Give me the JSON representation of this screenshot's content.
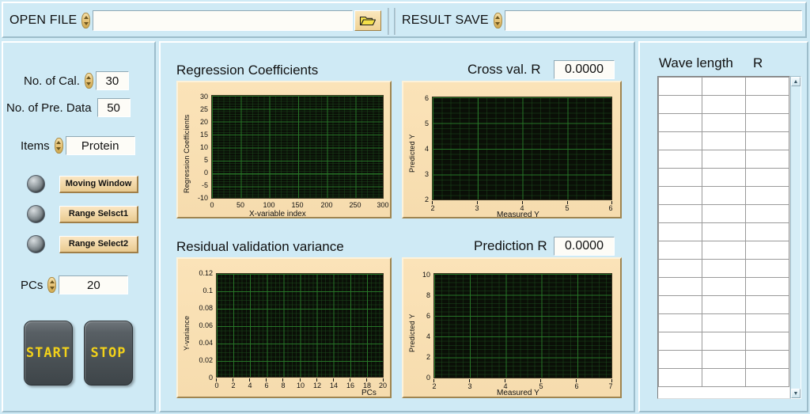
{
  "topbar": {
    "open_file_label": "OPEN FILE",
    "open_file_value": "",
    "open_file_icon": "folder-open-icon",
    "result_save_label": "RESULT SAVE",
    "result_save_value": ""
  },
  "controls": {
    "no_of_cal_label": "No. of Cal.",
    "no_of_cal_value": "30",
    "no_of_pre_data_label": "No. of Pre. Data",
    "no_of_pre_data_value": "50",
    "items_label": "Items",
    "items_value": "Protein",
    "pcs_label": "PCs",
    "pcs_value": "20",
    "toggles": [
      {
        "label": "Moving Window",
        "led": "off"
      },
      {
        "label": "Range Selsct1",
        "led": "off"
      },
      {
        "label": "Range Select2",
        "led": "off"
      }
    ],
    "start_label": "START",
    "stop_label": "STOP"
  },
  "readouts": {
    "cross_val_label": "Cross val. R",
    "cross_val_value": "0.0000",
    "prediction_label": "Prediction R",
    "prediction_value": "0.0000"
  },
  "table": {
    "header_wavelength": "Wave length",
    "header_r": "R",
    "columns": 3,
    "rows": 17,
    "cells": []
  },
  "colors": {
    "panel_bg": "#cfeaf5",
    "graph_bg": "#f8dfb0",
    "plot_bg": "#0a0f07",
    "grid_major": "#287828",
    "lcd_text": "#f2d11a",
    "tan_button": "#f0d6a4"
  },
  "chart_data": [
    {
      "id": "regression-coefficients",
      "type": "line",
      "title": "Regression Coefficients",
      "xlabel": "X-variable index",
      "ylabel": "Regression Coefficients",
      "xlim": [
        0,
        300
      ],
      "ylim": [
        -10,
        30
      ],
      "xticks": [
        "0",
        "50",
        "100",
        "150",
        "200",
        "250",
        "300"
      ],
      "yticks": [
        "30",
        "25",
        "20",
        "15",
        "10",
        "5",
        "0",
        "-5",
        "-10"
      ],
      "series": [
        {
          "name": "regression coefficients",
          "values": []
        }
      ],
      "grid": true,
      "legend": "none",
      "note": "empty plot - no data rendered"
    },
    {
      "id": "cross-validation",
      "type": "scatter",
      "title": "Cross val. R",
      "xlabel": "Measured Y",
      "ylabel": "Predicted Y",
      "xlim": [
        2,
        6
      ],
      "ylim": [
        2,
        6
      ],
      "xticks": [
        "2",
        "3",
        "4",
        "5",
        "6"
      ],
      "yticks": [
        "6",
        "5",
        "4",
        "3",
        "2"
      ],
      "series": [
        {
          "name": "cross validation",
          "values": []
        }
      ],
      "grid": true,
      "legend": "none",
      "note": "empty plot - no data rendered"
    },
    {
      "id": "residual-validation-variance",
      "type": "line",
      "title": "Residual validation variance",
      "xlabel": "PCs",
      "ylabel": "Y-variance",
      "xlim": [
        0,
        20
      ],
      "ylim": [
        0,
        0.12
      ],
      "xticks": [
        "0",
        "2",
        "4",
        "6",
        "8",
        "10",
        "12",
        "14",
        "16",
        "18",
        "20"
      ],
      "yticks": [
        "0.12",
        "0.1",
        "0.08",
        "0.06",
        "0.04",
        "0.02",
        "0"
      ],
      "series": [
        {
          "name": "Y-variance",
          "values": []
        }
      ],
      "grid": true,
      "legend": "none",
      "note": "empty plot - no data rendered"
    },
    {
      "id": "prediction",
      "type": "scatter",
      "title": "Prediction R",
      "xlabel": "Measured Y",
      "ylabel": "Predicted Y",
      "xlim": [
        2,
        7
      ],
      "ylim": [
        0,
        10
      ],
      "xticks": [
        "2",
        "3",
        "4",
        "5",
        "6",
        "7"
      ],
      "yticks": [
        "10",
        "8",
        "6",
        "4",
        "2",
        "0"
      ],
      "series": [
        {
          "name": "prediction",
          "values": []
        }
      ],
      "grid": true,
      "legend": "none",
      "note": "empty plot - no data rendered"
    }
  ]
}
